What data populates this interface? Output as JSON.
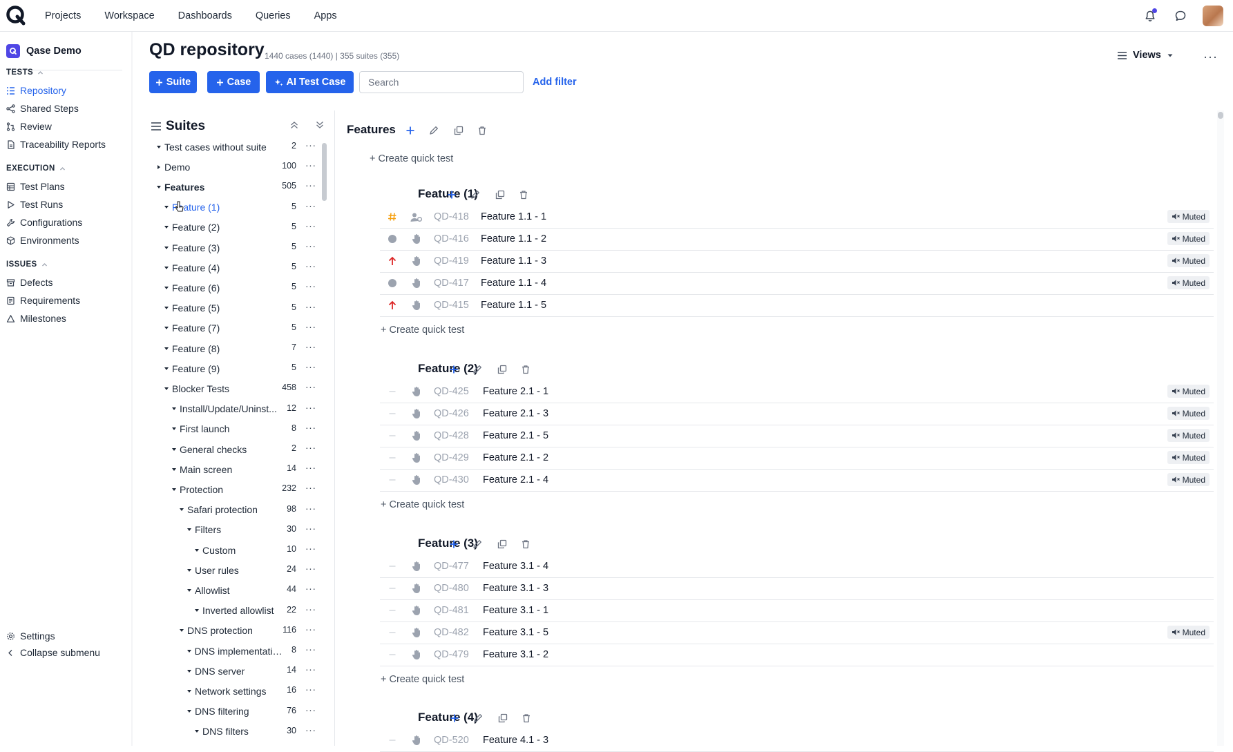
{
  "nav": {
    "items": [
      "Projects",
      "Workspace",
      "Dashboards",
      "Queries",
      "Apps"
    ]
  },
  "sidebar": {
    "project_name": "Qase Demo",
    "sections": {
      "tests": "TESTS",
      "execution": "EXECUTION",
      "issues": "ISSUES"
    },
    "tests_items": [
      "Repository",
      "Shared Steps",
      "Review",
      "Traceability Reports"
    ],
    "execution_items": [
      "Test Plans",
      "Test Runs",
      "Configurations",
      "Environments"
    ],
    "issues_items": [
      "Defects",
      "Requirements",
      "Milestones"
    ],
    "settings": "Settings",
    "collapse": "Collapse submenu"
  },
  "header": {
    "title": "QD repository",
    "meta": "1440 cases (1440) | 355 suites (355)",
    "views": "Views"
  },
  "toolbar": {
    "suite": "Suite",
    "case": "Case",
    "ai_case": "AI Test Case",
    "search_placeholder": "Search",
    "add_filter": "Add filter"
  },
  "suites_panel": {
    "title": "Suites",
    "tree": [
      {
        "label": "Test cases without suite",
        "count": "2",
        "bold": false
      },
      {
        "label": "Demo",
        "count": "100",
        "bold": false
      },
      {
        "label": "Features",
        "count": "505",
        "bold": true
      },
      {
        "label": "Feature (1)",
        "count": "5",
        "bold": false
      },
      {
        "label": "Feature (2)",
        "count": "5",
        "bold": false
      },
      {
        "label": "Feature (3)",
        "count": "5",
        "bold": false
      },
      {
        "label": "Feature (4)",
        "count": "5",
        "bold": false
      },
      {
        "label": "Feature (6)",
        "count": "5",
        "bold": false
      },
      {
        "label": "Feature (5)",
        "count": "5",
        "bold": false
      },
      {
        "label": "Feature (7)",
        "count": "5",
        "bold": false
      },
      {
        "label": "Feature (8)",
        "count": "7",
        "bold": false
      },
      {
        "label": "Feature (9)",
        "count": "5",
        "bold": false
      },
      {
        "label": "Blocker Tests",
        "count": "458",
        "bold": false
      },
      {
        "label": "Install/Update/Uninst...",
        "count": "12",
        "bold": false
      },
      {
        "label": "First launch",
        "count": "8",
        "bold": false
      },
      {
        "label": "General checks",
        "count": "2",
        "bold": false
      },
      {
        "label": "Main screen",
        "count": "14",
        "bold": false
      },
      {
        "label": "Protection",
        "count": "232",
        "bold": false
      },
      {
        "label": "Safari protection",
        "count": "98",
        "bold": false
      },
      {
        "label": "Filters",
        "count": "30",
        "bold": false
      },
      {
        "label": "Custom",
        "count": "10",
        "bold": false
      },
      {
        "label": "User rules",
        "count": "24",
        "bold": false
      },
      {
        "label": "Allowlist",
        "count": "44",
        "bold": false
      },
      {
        "label": "Inverted allowlist",
        "count": "22",
        "bold": false
      },
      {
        "label": "DNS protection",
        "count": "116",
        "bold": false
      },
      {
        "label": "DNS implementatio...",
        "count": "8",
        "bold": false
      },
      {
        "label": "DNS server",
        "count": "14",
        "bold": false
      },
      {
        "label": "Network settings",
        "count": "16",
        "bold": false
      },
      {
        "label": "DNS filtering",
        "count": "76",
        "bold": false
      },
      {
        "label": "DNS filters",
        "count": "30",
        "bold": false
      }
    ]
  },
  "main": {
    "root_suite": "Features",
    "create_quick_test": "+ Create quick test",
    "muted_label": "Muted",
    "suites": [
      {
        "title": "Feature (1)",
        "cases": [
          {
            "id": "QD-418",
            "title": "Feature 1.1 - 1",
            "priority": "hash",
            "type": "user",
            "muted": true
          },
          {
            "id": "QD-416",
            "title": "Feature 1.1 - 2",
            "priority": "dot",
            "type": "hand",
            "muted": true
          },
          {
            "id": "QD-419",
            "title": "Feature 1.1 - 3",
            "priority": "up",
            "type": "hand",
            "muted": true
          },
          {
            "id": "QD-417",
            "title": "Feature 1.1 - 4",
            "priority": "dot",
            "type": "hand",
            "muted": true
          },
          {
            "id": "QD-415",
            "title": "Feature 1.1 - 5",
            "priority": "up",
            "type": "hand",
            "muted": false
          }
        ]
      },
      {
        "title": "Feature (2)",
        "cases": [
          {
            "id": "QD-425",
            "title": "Feature 2.1 - 1",
            "priority": "dash",
            "type": "hand",
            "muted": true
          },
          {
            "id": "QD-426",
            "title": "Feature 2.1 - 3",
            "priority": "dash",
            "type": "hand",
            "muted": true
          },
          {
            "id": "QD-428",
            "title": "Feature 2.1 - 5",
            "priority": "dash",
            "type": "hand",
            "muted": true
          },
          {
            "id": "QD-429",
            "title": "Feature 2.1 - 2",
            "priority": "dash",
            "type": "hand",
            "muted": true
          },
          {
            "id": "QD-430",
            "title": "Feature 2.1 - 4",
            "priority": "dash",
            "type": "hand",
            "muted": true
          }
        ]
      },
      {
        "title": "Feature (3)",
        "cases": [
          {
            "id": "QD-477",
            "title": "Feature 3.1 - 4",
            "priority": "dash",
            "type": "hand",
            "muted": false
          },
          {
            "id": "QD-480",
            "title": "Feature 3.1 - 3",
            "priority": "dash",
            "type": "hand",
            "muted": false
          },
          {
            "id": "QD-481",
            "title": "Feature 3.1 - 1",
            "priority": "dash",
            "type": "hand",
            "muted": false
          },
          {
            "id": "QD-482",
            "title": "Feature 3.1 - 5",
            "priority": "dash",
            "type": "hand",
            "muted": true
          },
          {
            "id": "QD-479",
            "title": "Feature 3.1 - 2",
            "priority": "dash",
            "type": "hand",
            "muted": false
          }
        ]
      },
      {
        "title": "Feature (4)",
        "cases": [
          {
            "id": "QD-520",
            "title": "Feature 4.1 - 3",
            "priority": "dash",
            "type": "hand",
            "muted": false
          }
        ]
      }
    ]
  },
  "colors": {
    "accent": "#2563eb",
    "priority_high": "#dc2626",
    "priority_hash": "#f59e0b",
    "muted_bg": "#eef0f3"
  }
}
